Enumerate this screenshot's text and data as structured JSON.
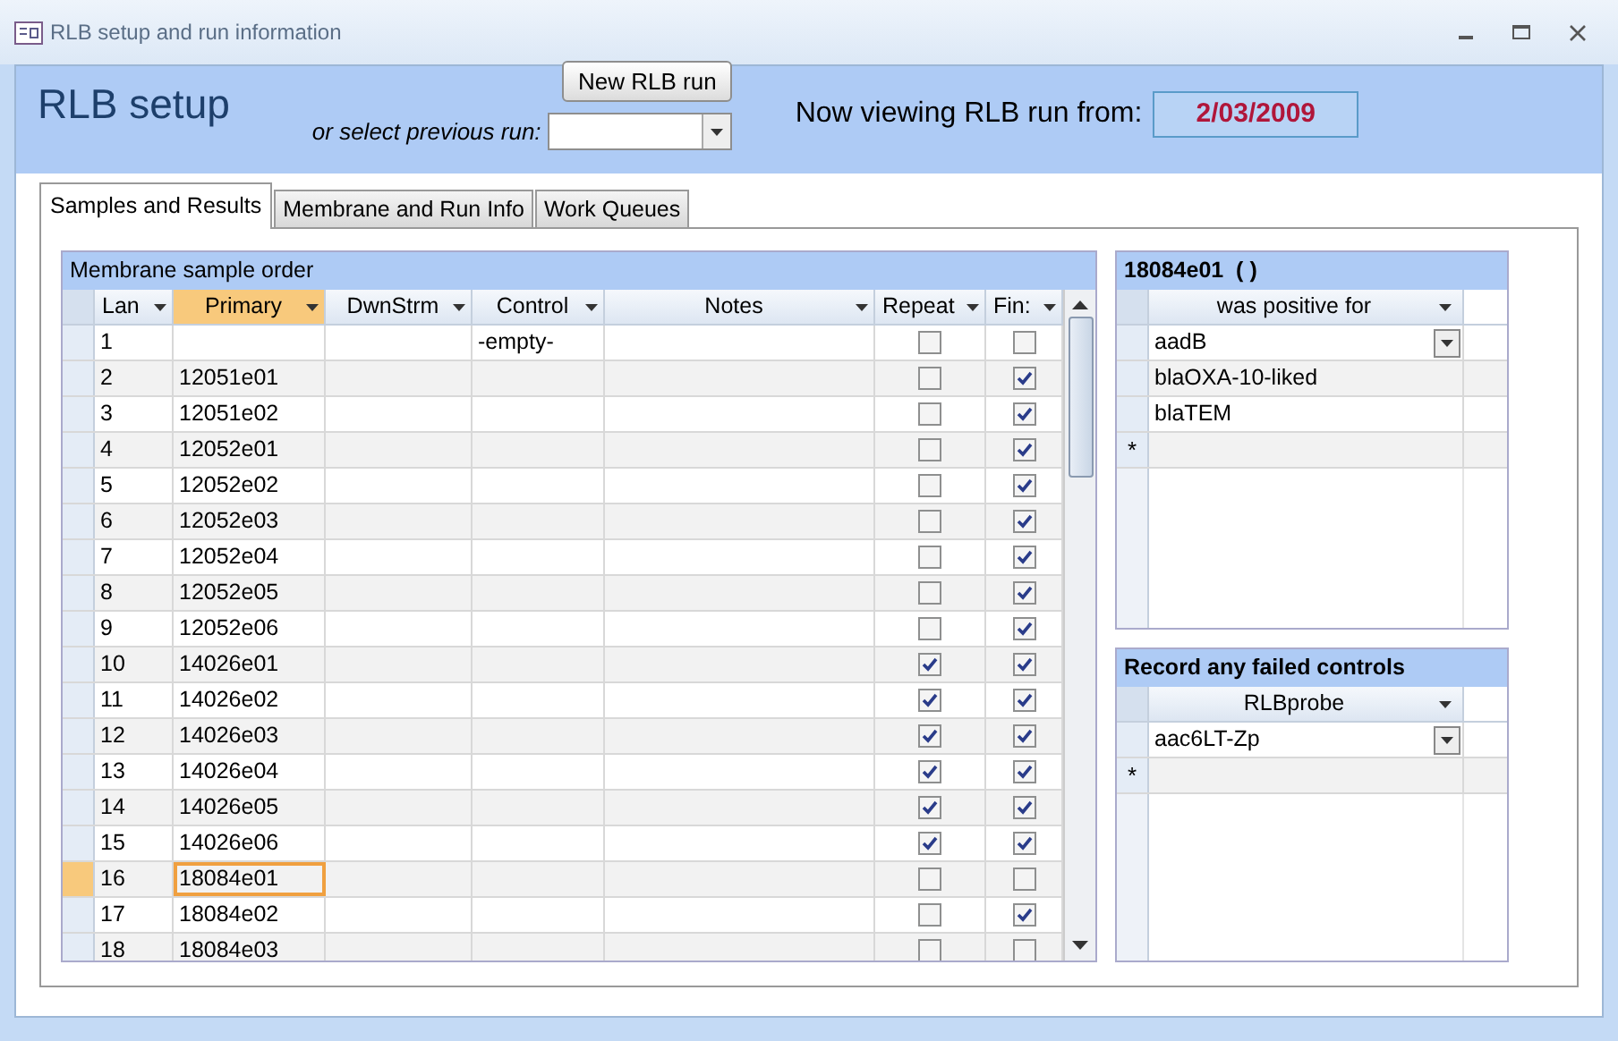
{
  "window": {
    "title": "RLB setup and run information"
  },
  "header": {
    "title": "RLB setup",
    "new_button": "New RLB run",
    "select_label": "or select previous run:",
    "viewing_label": "Now viewing RLB run from:",
    "viewing_date": "2/03/2009"
  },
  "tabs": [
    {
      "label": "Samples and Results",
      "selected": true
    },
    {
      "label": "Membrane and Run Info",
      "selected": false
    },
    {
      "label": "Work Queues",
      "selected": false
    }
  ],
  "sample_table": {
    "title": "Membrane sample order",
    "columns": [
      {
        "label": "Lan",
        "selected": false
      },
      {
        "label": "Primary",
        "selected": true
      },
      {
        "label": "DwnStrm",
        "selected": false
      },
      {
        "label": "Control",
        "selected": false
      },
      {
        "label": "Notes",
        "selected": false
      },
      {
        "label": "Repeat",
        "selected": false
      },
      {
        "label": "Fin:",
        "selected": false
      }
    ],
    "rows": [
      {
        "lane": "1",
        "primary": "",
        "dwnstrm": "",
        "control": "-empty-",
        "notes": "",
        "repeat": false,
        "final": false,
        "selected": false
      },
      {
        "lane": "2",
        "primary": "12051e01",
        "dwnstrm": "",
        "control": "",
        "notes": "",
        "repeat": false,
        "final": true,
        "selected": false
      },
      {
        "lane": "3",
        "primary": "12051e02",
        "dwnstrm": "",
        "control": "",
        "notes": "",
        "repeat": false,
        "final": true,
        "selected": false
      },
      {
        "lane": "4",
        "primary": "12052e01",
        "dwnstrm": "",
        "control": "",
        "notes": "",
        "repeat": false,
        "final": true,
        "selected": false
      },
      {
        "lane": "5",
        "primary": "12052e02",
        "dwnstrm": "",
        "control": "",
        "notes": "",
        "repeat": false,
        "final": true,
        "selected": false
      },
      {
        "lane": "6",
        "primary": "12052e03",
        "dwnstrm": "",
        "control": "",
        "notes": "",
        "repeat": false,
        "final": true,
        "selected": false
      },
      {
        "lane": "7",
        "primary": "12052e04",
        "dwnstrm": "",
        "control": "",
        "notes": "",
        "repeat": false,
        "final": true,
        "selected": false
      },
      {
        "lane": "8",
        "primary": "12052e05",
        "dwnstrm": "",
        "control": "",
        "notes": "",
        "repeat": false,
        "final": true,
        "selected": false
      },
      {
        "lane": "9",
        "primary": "12052e06",
        "dwnstrm": "",
        "control": "",
        "notes": "",
        "repeat": false,
        "final": true,
        "selected": false
      },
      {
        "lane": "10",
        "primary": "14026e01",
        "dwnstrm": "",
        "control": "",
        "notes": "",
        "repeat": true,
        "final": true,
        "selected": false
      },
      {
        "lane": "11",
        "primary": "14026e02",
        "dwnstrm": "",
        "control": "",
        "notes": "",
        "repeat": true,
        "final": true,
        "selected": false
      },
      {
        "lane": "12",
        "primary": "14026e03",
        "dwnstrm": "",
        "control": "",
        "notes": "",
        "repeat": true,
        "final": true,
        "selected": false
      },
      {
        "lane": "13",
        "primary": "14026e04",
        "dwnstrm": "",
        "control": "",
        "notes": "",
        "repeat": true,
        "final": true,
        "selected": false
      },
      {
        "lane": "14",
        "primary": "14026e05",
        "dwnstrm": "",
        "control": "",
        "notes": "",
        "repeat": true,
        "final": true,
        "selected": false
      },
      {
        "lane": "15",
        "primary": "14026e06",
        "dwnstrm": "",
        "control": "",
        "notes": "",
        "repeat": true,
        "final": true,
        "selected": false
      },
      {
        "lane": "16",
        "primary": "18084e01",
        "dwnstrm": "",
        "control": "",
        "notes": "",
        "repeat": false,
        "final": false,
        "selected": true
      },
      {
        "lane": "17",
        "primary": "18084e02",
        "dwnstrm": "",
        "control": "",
        "notes": "",
        "repeat": false,
        "final": true,
        "selected": false
      },
      {
        "lane": "18",
        "primary": "18084e03",
        "dwnstrm": "",
        "control": "",
        "notes": "",
        "repeat": false,
        "final": false,
        "selected": false
      }
    ]
  },
  "positive_table": {
    "title": "18084e01  ( )",
    "column": "was positive for",
    "rows": [
      "aadB",
      "blaOXA-10-liked",
      "blaTEM"
    ],
    "new_row_mark": "*"
  },
  "failed_table": {
    "title": "Record any failed controls",
    "column": "RLBprobe",
    "rows": [
      "aac6LT-Zp"
    ],
    "new_row_mark": "*"
  }
}
